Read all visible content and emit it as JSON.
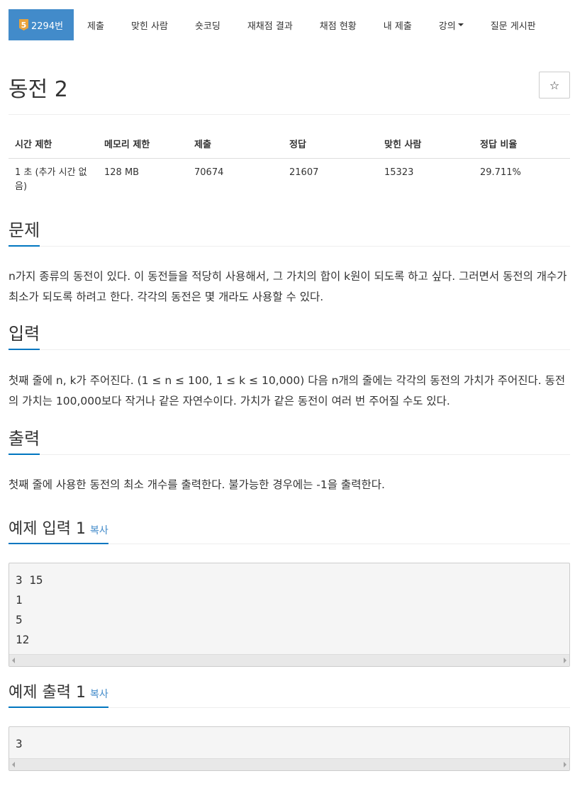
{
  "nav": {
    "problem_badge": "5",
    "problem_number": "2294번",
    "items": [
      "제출",
      "맞힌 사람",
      "숏코딩",
      "재채점 결과",
      "채점 현황",
      "내 제출",
      "강의",
      "질문 게시판"
    ]
  },
  "problem": {
    "title": "동전 2",
    "star": "☆"
  },
  "info_table": {
    "headers": [
      "시간 제한",
      "메모리 제한",
      "제출",
      "정답",
      "맞힌 사람",
      "정답 비율"
    ],
    "row": [
      "1 초 (추가 시간 없음)",
      "128 MB",
      "70674",
      "21607",
      "15323",
      "29.711%"
    ]
  },
  "sections": {
    "description_title": "문제",
    "description": "n가지 종류의 동전이 있다. 이 동전들을 적당히 사용해서, 그 가치의 합이 k원이 되도록 하고 싶다. 그러면서 동전의 개수가 최소가 되도록 하려고 한다. 각각의 동전은 몇 개라도 사용할 수 있다.",
    "input_title": "입력",
    "input": "첫째 줄에 n, k가 주어진다. (1 ≤ n ≤ 100, 1 ≤ k ≤ 10,000) 다음 n개의 줄에는 각각의 동전의 가치가 주어진다. 동전의 가치는 100,000보다 작거나 같은 자연수이다. 가치가 같은 동전이 여러 번 주어질 수도 있다.",
    "output_title": "출력",
    "output": "첫째 줄에 사용한 동전의 최소 개수를 출력한다. 불가능한 경우에는 -1을 출력한다."
  },
  "samples": {
    "input_title": "예제 입력 1",
    "input_copy": "복사",
    "input_text": "3 15\n1\n5\n12",
    "output_title": "예제 출력 1",
    "output_copy": "복사",
    "output_text": "3"
  },
  "colors": {
    "accent": "#428bca",
    "section_underline": "#0076c0",
    "tier_badge": "#e8a33d"
  }
}
